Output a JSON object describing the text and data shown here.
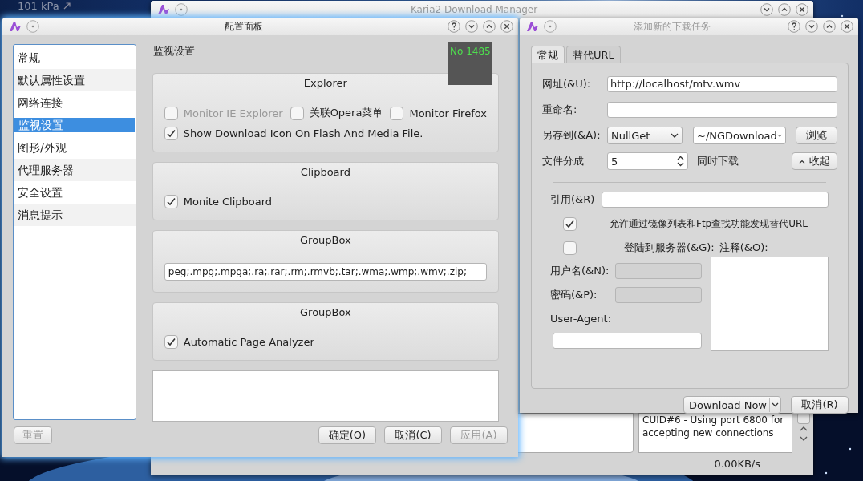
{
  "desktop": {
    "widget_text": "101 kPa"
  },
  "background_window": {
    "title": "Karia2 Download Manager",
    "active": false,
    "log_text": "CUID#6 - Using port 6800 for accepting new connections",
    "speed": "0.00KB/s"
  },
  "config_dialog": {
    "title": "配置面板",
    "active": true,
    "categories": [
      {
        "label": "常规",
        "selected": false
      },
      {
        "label": "默认属性设置",
        "selected": false
      },
      {
        "label": "网络连接",
        "selected": false
      },
      {
        "label": "监视设置",
        "selected": true
      },
      {
        "label": "图形/外观",
        "selected": false
      },
      {
        "label": "代理服务器",
        "selected": false
      },
      {
        "label": "安全设置",
        "selected": false
      },
      {
        "label": "消息提示",
        "selected": false
      }
    ],
    "page_title": "监视设置",
    "overlay_counter": "No 1485",
    "groups": [
      {
        "title": "Explorer",
        "kind": "checkboxes",
        "rows": [
          [
            {
              "label": "Monitor IE Explorer",
              "checked": false,
              "disabled": true
            },
            {
              "label": "关联Opera菜单",
              "checked": false,
              "disabled": false
            },
            {
              "label": "Monitor Firefox",
              "checked": false,
              "disabled": false
            }
          ],
          [
            {
              "label": "Show Download Icon On Flash And Media File.",
              "checked": true,
              "disabled": false
            }
          ]
        ]
      },
      {
        "title": "Clipboard",
        "kind": "checkboxes",
        "rows": [
          [
            {
              "label": "Monite Clipboard",
              "checked": true,
              "disabled": false
            }
          ]
        ]
      },
      {
        "title": "GroupBox",
        "kind": "field",
        "value": "peg;.mpg;.mpga;.ra;.rar;.rm;.rmvb;.tar;.wma;.wmp;.wmv;.zip;"
      },
      {
        "title": "GroupBox",
        "kind": "checkboxes",
        "rows": [
          [
            {
              "label": "Automatic Page Analyzer",
              "checked": true,
              "disabled": false
            }
          ]
        ]
      }
    ],
    "reset_button": {
      "label": "重置",
      "disabled": true
    },
    "buttons": [
      {
        "label": "确定(O)",
        "disabled": false
      },
      {
        "label": "取消(C)",
        "disabled": false
      },
      {
        "label": "应用(A)",
        "disabled": true
      }
    ]
  },
  "add_task_dialog": {
    "title": "添加新的下载任务",
    "active": false,
    "tabs": [
      {
        "label": "常规",
        "selected": true
      },
      {
        "label": "替代URL",
        "selected": false
      }
    ],
    "url": {
      "label": "网址(&U):",
      "value": "http://localhost/mtv.wmv"
    },
    "rename": {
      "label": "重命名:"
    },
    "save_to": {
      "label": "另存到(&A):",
      "category": "NullGet",
      "directory": "~/NGDownload",
      "browse_button": "浏览"
    },
    "segments": {
      "label": "文件分成",
      "value": "5",
      "suffix": "同时下载"
    },
    "collapse_button": "收起",
    "referer": {
      "label": "引用(&R)"
    },
    "mirror_search": {
      "label": "允许通过镜像列表和Ftp查找功能发现替代URL",
      "checked": true
    },
    "login": {
      "label": "登陆到服务器(&G):",
      "checked": false
    },
    "comment": {
      "label": "注释(&O):"
    },
    "username": {
      "label": "用户名(&N):",
      "disabled": true
    },
    "password": {
      "label": "密码(&P):",
      "disabled": true
    },
    "user_agent": {
      "label": "User-Agent:"
    },
    "buttons": [
      {
        "label": "Download Now",
        "kind": "split"
      },
      {
        "label": "取消(R)",
        "kind": "plain"
      }
    ]
  }
}
